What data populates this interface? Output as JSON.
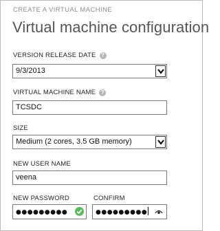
{
  "header": {
    "eyebrow": "CREATE A VIRTUAL MACHINE",
    "title": "Virtual machine configuration"
  },
  "form": {
    "version_release_date": {
      "label": "VERSION RELEASE DATE",
      "value": "9/3/2013",
      "help_icon": "question-icon"
    },
    "vm_name": {
      "label": "VIRTUAL MACHINE NAME",
      "value": "TCSDC",
      "help_icon": "question-icon"
    },
    "size": {
      "label": "SIZE",
      "value": "Medium (2 cores, 3.5 GB memory)"
    },
    "user_name": {
      "label": "NEW USER NAME",
      "value": "veena"
    },
    "password": {
      "label": "NEW PASSWORD",
      "masked": "●●●●●●●●●",
      "status_icon": "check-icon",
      "status_color": "#5cb85c"
    },
    "confirm": {
      "label": "CONFIRM",
      "masked": "●●●●●●●●●",
      "reveal_icon": "eye-icon"
    }
  },
  "help_glyph": "?"
}
